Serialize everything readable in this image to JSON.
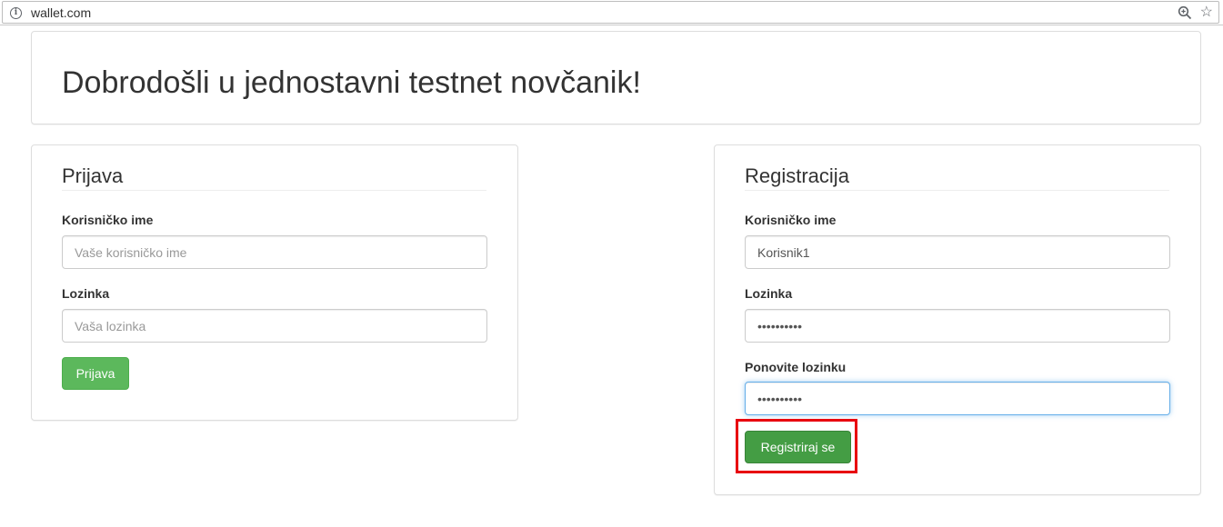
{
  "browser": {
    "url": "wallet.com",
    "info_icon": "i"
  },
  "hero": {
    "title": "Dobrodošli u jednostavni testnet novčanik!"
  },
  "login": {
    "heading": "Prijava",
    "username_label": "Korisničko ime",
    "username_placeholder": "Vaše korisničko ime",
    "password_label": "Lozinka",
    "password_placeholder": "Vaša lozinka",
    "submit_label": "Prijava"
  },
  "register": {
    "heading": "Registracija",
    "username_label": "Korisničko ime",
    "username_value": "Korisnik1",
    "password_label": "Lozinka",
    "password_value": "••••••••••",
    "repeat_label": "Ponovite lozinku",
    "repeat_value": "••••••••••",
    "submit_label": "Registriraj se"
  },
  "colors": {
    "button_green": "#5cb85c",
    "highlight_red": "#e8000f",
    "focus_blue": "#66afe9"
  }
}
